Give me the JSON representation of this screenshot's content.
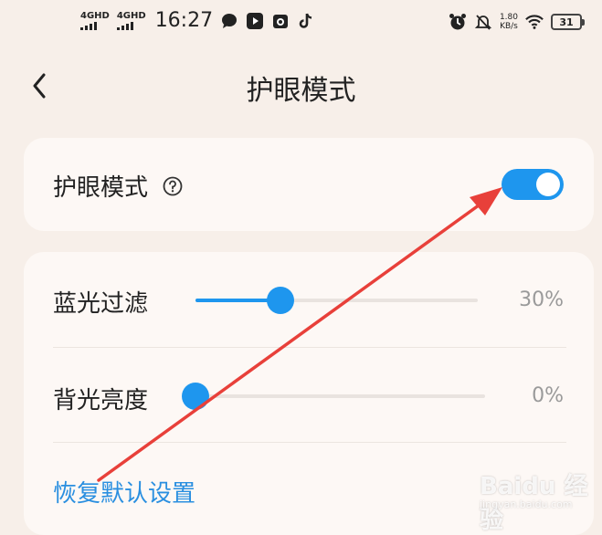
{
  "status_bar": {
    "network1": "4GHD",
    "network2": "4GHD",
    "time": "16:27",
    "speed_value": "1.80",
    "speed_unit": "KB/s",
    "battery": "31",
    "icons": [
      "chat-bubble-icon",
      "video-play-icon",
      "robot-icon",
      "tiktok-icon",
      "alarm-icon",
      "mute-bell-icon",
      "wifi-icon",
      "battery-icon"
    ]
  },
  "header": {
    "title": "护眼模式"
  },
  "eye_mode": {
    "label": "护眼模式",
    "enabled": true
  },
  "sliders": [
    {
      "label": "蓝光过滤",
      "value_text": "30%",
      "level": 0.3
    },
    {
      "label": "背光亮度",
      "value_text": "0%",
      "level": 0.0
    }
  ],
  "reset_label": "恢复默认设置",
  "watermark": {
    "logo_text": "Bai",
    "logo_text2": "经验",
    "sub": "jingyan.baidu.com"
  },
  "colors": {
    "accent": "#1e96ee",
    "background": "#f7efe9",
    "card": "#fdf8f5",
    "annotation_arrow": "#e8403a"
  }
}
